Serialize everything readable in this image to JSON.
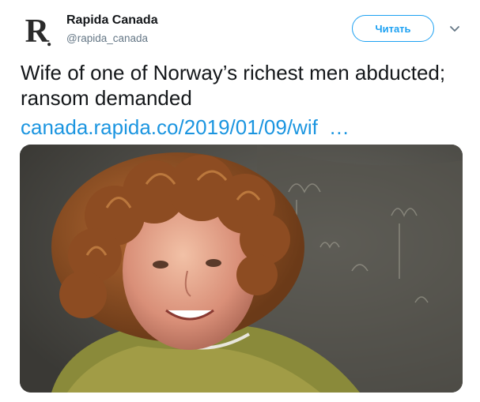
{
  "account": {
    "logo_letter": "R",
    "logo_dot": ".",
    "name": "Rapida Canada",
    "handle": "@rapida_canada"
  },
  "actions": {
    "follow_label": "Читать"
  },
  "tweet": {
    "text": "Wife of one of Norway’s richest men abducted; ransom demanded",
    "link_text": "canada.rapida.co/2019/01/09/wif",
    "link_ellipsis": "…"
  },
  "colors": {
    "accent": "#1da1f2",
    "link": "#1b95e0",
    "muted": "#657786"
  },
  "icons": {
    "caret": "chevron-down-icon"
  }
}
